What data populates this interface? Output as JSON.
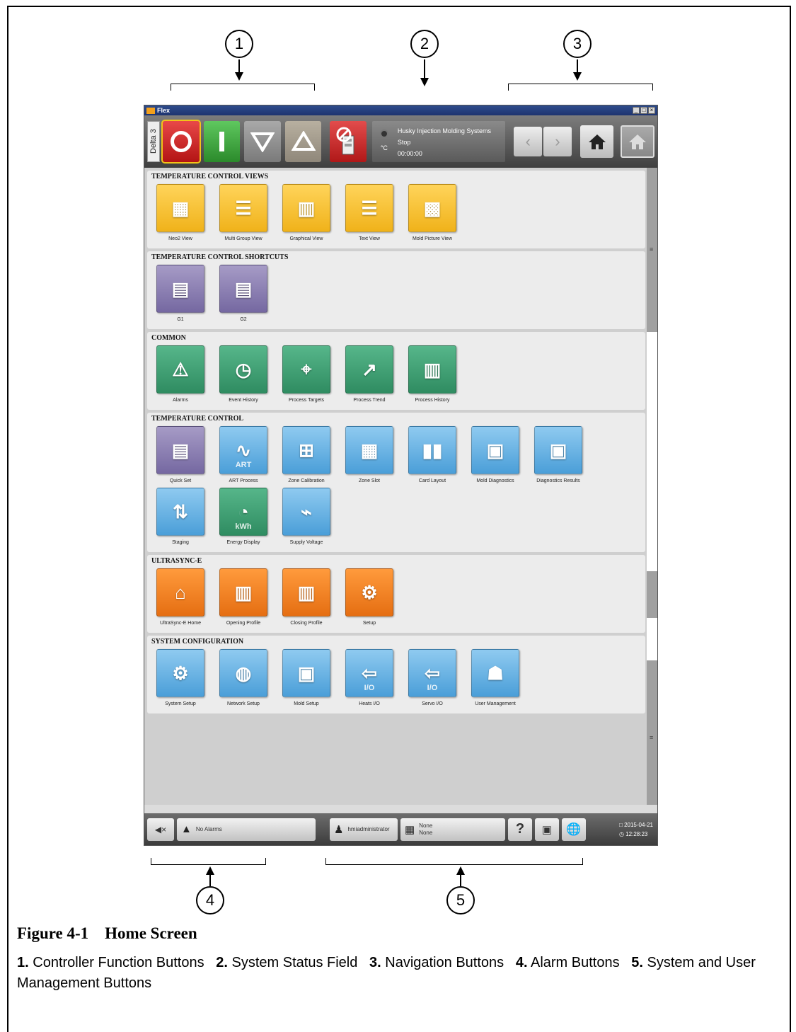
{
  "callouts": [
    "1",
    "2",
    "3",
    "4",
    "5"
  ],
  "app": {
    "title": "Flex",
    "window_buttons": [
      "_",
      "□",
      "×"
    ],
    "toolbar": {
      "delta_label": "Delta 3",
      "status_company": "Husky Injection Molding Systems",
      "status_state": "Stop",
      "status_unit": "°C",
      "status_time": "00:00:00"
    },
    "sections": [
      {
        "title": "TEMPERATURE CONTROL VIEWS",
        "tiles": [
          {
            "label": "Neo2 View",
            "color": "yellow",
            "icon": "neo2-view-icon"
          },
          {
            "label": "Multi Group View",
            "color": "yellow",
            "icon": "multi-group-view-icon"
          },
          {
            "label": "Graphical View",
            "color": "yellow",
            "icon": "graphical-view-icon"
          },
          {
            "label": "Text View",
            "color": "yellow",
            "icon": "text-view-icon"
          },
          {
            "label": "Mold Picture View",
            "color": "yellow",
            "icon": "mold-picture-view-icon"
          }
        ]
      },
      {
        "title": "TEMPERATURE CONTROL SHORTCUTS",
        "tiles": [
          {
            "label": "G1",
            "color": "purple",
            "icon": "thermometer-group-icon"
          },
          {
            "label": "G2",
            "color": "purple",
            "icon": "thermometer-group-icon"
          }
        ]
      },
      {
        "title": "COMMON",
        "tiles": [
          {
            "label": "Alarms",
            "color": "green",
            "icon": "warning-triangle-icon"
          },
          {
            "label": "Event History",
            "color": "green",
            "icon": "clock-history-icon"
          },
          {
            "label": "Process Targets",
            "color": "green",
            "icon": "target-chart-icon"
          },
          {
            "label": "Process Trend",
            "color": "green",
            "icon": "trend-chart-icon"
          },
          {
            "label": "Process History",
            "color": "green",
            "icon": "bar-history-icon"
          }
        ]
      },
      {
        "title": "TEMPERATURE CONTROL",
        "tiles": [
          {
            "label": "Quick Set",
            "color": "purple",
            "icon": "thermometer-group-icon"
          },
          {
            "label": "ART Process",
            "color": "blue",
            "icon": "art-wave-icon",
            "text": "ART"
          },
          {
            "label": "Zone Calibration",
            "color": "blue",
            "icon": "multimeter-icon"
          },
          {
            "label": "Zone Slot",
            "color": "blue",
            "icon": "zone-slot-icon"
          },
          {
            "label": "Card Layout",
            "color": "blue",
            "icon": "card-layout-icon"
          },
          {
            "label": "Mold Diagnostics",
            "color": "blue",
            "icon": "mold-diagnostics-icon"
          },
          {
            "label": "Diagnostics Results",
            "color": "blue",
            "icon": "diagnostics-results-icon"
          },
          {
            "label": "Staging",
            "color": "blue",
            "icon": "staging-icon"
          },
          {
            "label": "Energy Display",
            "color": "green",
            "icon": "energy-gauge-icon",
            "text": "kWh"
          },
          {
            "label": "Supply Voltage",
            "color": "blue",
            "icon": "voltage-meter-icon"
          }
        ]
      },
      {
        "title": "ULTRASYNC-E",
        "tiles": [
          {
            "label": "UltraSync-E Home",
            "color": "orange",
            "icon": "ultrasync-home-icon"
          },
          {
            "label": "Opening Profile",
            "color": "orange",
            "icon": "opening-profile-icon"
          },
          {
            "label": "Closing Profile",
            "color": "orange",
            "icon": "closing-profile-icon"
          },
          {
            "label": "Setup",
            "color": "orange",
            "icon": "setup-gear-icon"
          }
        ]
      },
      {
        "title": "SYSTEM CONFIGURATION",
        "tiles": [
          {
            "label": "System Setup",
            "color": "blue",
            "icon": "system-gears-icon"
          },
          {
            "label": "Network Setup",
            "color": "blue",
            "icon": "globe-network-icon"
          },
          {
            "label": "Mold Setup",
            "color": "blue",
            "icon": "mold-folder-icon"
          },
          {
            "label": "Heats I/O",
            "color": "blue",
            "icon": "heats-io-icon",
            "text": "I/O"
          },
          {
            "label": "Servo I/O",
            "color": "blue",
            "icon": "servo-io-icon",
            "text": "I/O"
          },
          {
            "label": "User Management",
            "color": "blue",
            "icon": "users-icon"
          }
        ]
      }
    ],
    "footer": {
      "alarm_text": "No Alarms",
      "user": "hmiadministrator",
      "mold_line1": "None",
      "mold_line2": "None",
      "date": "2015-04-21",
      "time": "12:28:23"
    }
  },
  "caption": {
    "figure": "Figure 4-1    Home Screen",
    "items": [
      {
        "num": "1.",
        "text": "Controller Function Buttons"
      },
      {
        "num": "2.",
        "text": "System Status Field"
      },
      {
        "num": "3.",
        "text": "Navigation Buttons"
      },
      {
        "num": "4.",
        "text": "Alarm Buttons"
      },
      {
        "num": "5.",
        "text": "System and User Management Buttons"
      }
    ]
  },
  "colors": {
    "yellow": "#f5bd2a",
    "purple": "#8a7fb4",
    "green": "#3fa374",
    "blue": "#66b3e6",
    "orange": "#f27f22",
    "stop_red": "#d42424",
    "start_green": "#3aa83a"
  }
}
